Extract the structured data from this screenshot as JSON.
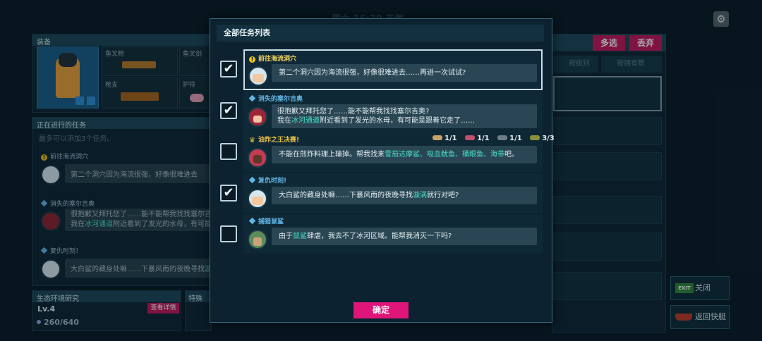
{
  "background": {
    "top_title": "周六 16:30 天气",
    "equip": {
      "title": "装备",
      "slots": [
        "鱼叉枪",
        "鱼叉剑",
        "枪支",
        "护符"
      ]
    },
    "tasks": {
      "title": "正在进行的任务",
      "hint": "最多可以添加3个任务。",
      "items": [
        {
          "title": "前往海流洞穴",
          "text": "第二个洞穴因为海流很强，好像很难进去"
        },
        {
          "title": "消失的塞尔吉奥",
          "line1": "很抱歉又拜托您了……能不能帮我找找塞尔吉",
          "line2_a": "我在",
          "line2_hl": "冰河通道",
          "line2_b": "附近看到了发光的水母，有可能"
        },
        {
          "title": "复仇时刻！",
          "text_a": "大白鲨的藏身处嘛……下暴风雨的夜晚寻找",
          "text_hl": "漩"
        }
      ]
    },
    "eco": {
      "title": "生态环境研究",
      "level": "Lv.4",
      "view_button": "查看详情",
      "xp": "260/640"
    },
    "special": {
      "title": "特殊"
    },
    "right": {
      "multi_select": "多选",
      "discard": "丢弃",
      "sort_level": "按级别",
      "sort_count": "按拥有数"
    },
    "close_button": "关闭",
    "exit_label": "EXIT",
    "return_button": "返回快艇"
  },
  "modal": {
    "title": "全部任务列表",
    "confirm": "确定",
    "tasks": [
      {
        "checked": true,
        "name": "前往海流洞穴",
        "line1": "第二个洞穴因为海流很强，好像很难进去……再进一次试试?",
        "check": "✔"
      },
      {
        "checked": true,
        "name": "消失的塞尔吉奥",
        "line1": "很抱歉又拜托您了……能不能帮我找找塞尔吉奥?",
        "line2_a": "我在",
        "line2_hl": "冰河通道",
        "line2_b": "附近看到了发光的水母，有可能是跟着它走了……",
        "check": "✔"
      },
      {
        "checked": false,
        "name": "油炸之王决赛!",
        "line1_a": "不能在煎炸料理上输掉。帮我找来",
        "line1_hl": "雪茄达摩鲨、吸血鱿鱼、桶眼鱼、海带",
        "line1_b": "吧。",
        "requirements": [
          "1/1",
          "1/1",
          "1/1",
          "3/3"
        ],
        "check": ""
      },
      {
        "checked": true,
        "name": "复仇时刻!",
        "line1_a": "大白鲨的藏身处嘛……下暴风雨的夜晚寻找",
        "line1_hl": "漩涡",
        "line1_b": "就行对吧?",
        "check": "✔"
      },
      {
        "checked": false,
        "name": "捕猎鼠鲨",
        "line1_a": "由于",
        "line1_hl": "鼠鲨",
        "line1_b": "肆虐，我去不了冰河区域。能帮我消灭一下吗?",
        "check": ""
      }
    ]
  },
  "colors": {
    "accent_pink": "#e0157a",
    "highlight_teal": "#48e0c6",
    "title_yellow": "#f1d35a"
  }
}
